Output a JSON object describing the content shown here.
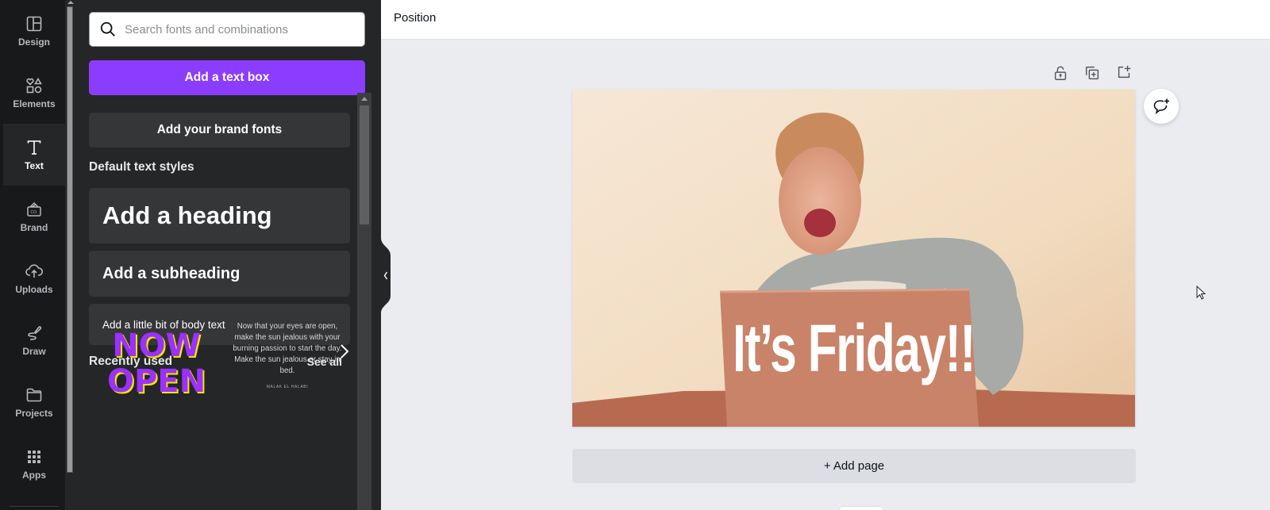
{
  "sidebar": {
    "items": [
      {
        "label": "Design",
        "icon": "layout-icon"
      },
      {
        "label": "Elements",
        "icon": "shapes-icon"
      },
      {
        "label": "Text",
        "icon": "text-icon",
        "active": true
      },
      {
        "label": "Brand",
        "icon": "brand-kit-icon"
      },
      {
        "label": "Uploads",
        "icon": "cloud-upload-icon"
      },
      {
        "label": "Draw",
        "icon": "pen-icon"
      },
      {
        "label": "Projects",
        "icon": "folder-icon"
      },
      {
        "label": "Apps",
        "icon": "grid-icon"
      }
    ]
  },
  "text_panel": {
    "search": {
      "placeholder": "Search fonts and combinations",
      "value": ""
    },
    "add_text_box_label": "Add a text box",
    "brand_fonts_label": "Add your brand fonts",
    "default_styles_title": "Default text styles",
    "heading_label": "Add a heading",
    "subheading_label": "Add a subheading",
    "body_label": "Add a little bit of body text",
    "recently_used_title": "Recently used",
    "see_all_label": "See all",
    "recent": [
      {
        "name": "now-open-combo",
        "lines": [
          "NOW",
          "OPEN"
        ]
      },
      {
        "name": "quote-combo",
        "text": "Now that your eyes are open, make the sun jealous with your burning passion to start the day. Make the sun jealous or stay in bed.",
        "author": "MALAK EL HALABI"
      }
    ]
  },
  "topbar": {
    "position_label": "Position"
  },
  "canvas": {
    "caption": "It’s Friday!!",
    "add_page_label": "+ Add page",
    "page_tools": [
      "lock-icon",
      "duplicate-page-icon",
      "add-page-icon"
    ]
  },
  "colors": {
    "accent": "#8b3dff",
    "rail_bg": "#18191b",
    "panel_bg": "#252627",
    "card_bg": "#353638",
    "canvas_bg": "#ebecf0"
  }
}
